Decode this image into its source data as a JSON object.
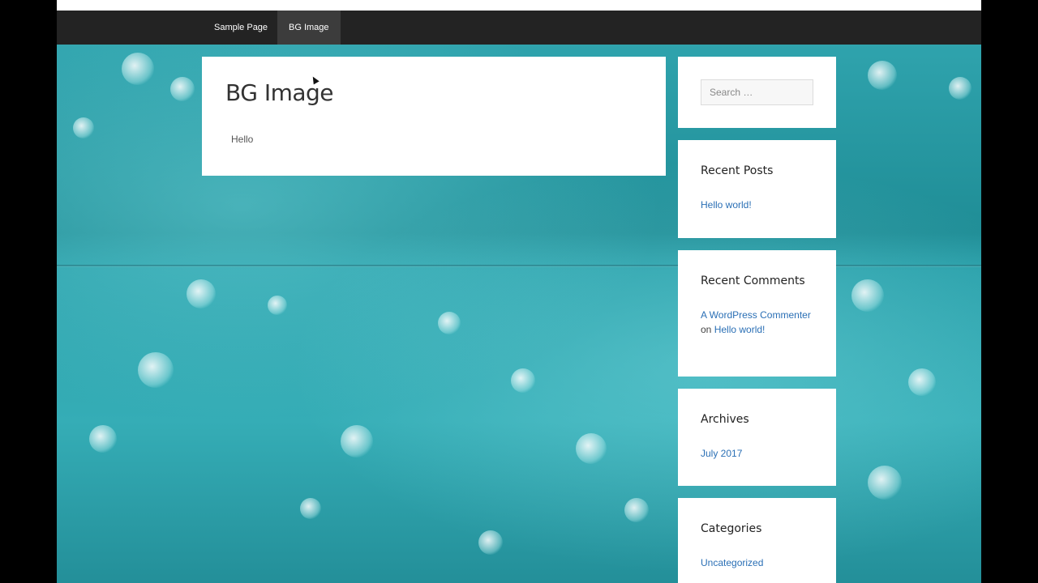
{
  "nav": {
    "items": [
      {
        "label": "Sample Page"
      },
      {
        "label": "BG Image"
      }
    ]
  },
  "post": {
    "title": "BG Image",
    "body": "Hello"
  },
  "sidebar": {
    "search_placeholder": "Search …",
    "recent_posts": {
      "title": "Recent Posts",
      "items": [
        "Hello world!"
      ]
    },
    "recent_comments": {
      "title": "Recent Comments",
      "author": "A WordPress Commenter",
      "connector": "on",
      "post": "Hello world!"
    },
    "archives": {
      "title": "Archives",
      "items": [
        "July 2017"
      ]
    },
    "categories": {
      "title": "Categories",
      "items": [
        "Uncategorized"
      ]
    }
  }
}
